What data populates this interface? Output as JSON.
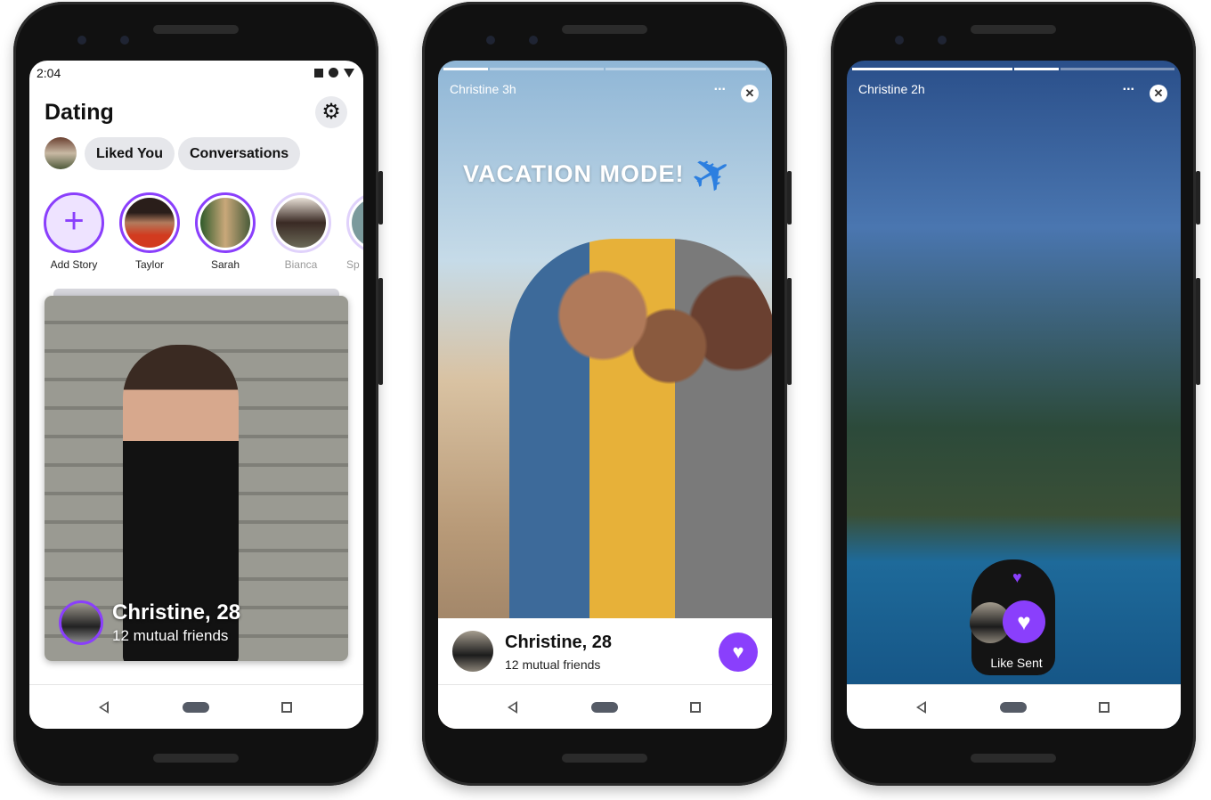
{
  "accent": "#8a3ffc",
  "phone1": {
    "status": {
      "time": "2:04"
    },
    "title": "Dating",
    "settings_icon": "gear-icon",
    "tabs": [
      {
        "label": "Liked You"
      },
      {
        "label": "Conversations"
      }
    ],
    "stories": [
      {
        "label": "Add Story"
      },
      {
        "label": "Taylor"
      },
      {
        "label": "Sarah"
      },
      {
        "label": "Bianca"
      },
      {
        "label": "Sp"
      }
    ],
    "card": {
      "name": "Christine, 28",
      "subtitle": "12 mutual friends"
    }
  },
  "phone2": {
    "story_author": "Christine 3h",
    "overlay_text": "VACATION MODE!",
    "profile": {
      "name": "Christine, 28",
      "subtitle": "12 mutual friends"
    }
  },
  "phone3": {
    "story_author": "Christine 2h",
    "toast": "Like Sent"
  },
  "icons": {
    "more": "...",
    "close": "✕",
    "heart": "♥",
    "plane": "✈",
    "add": "+",
    "gear": "⚙"
  }
}
